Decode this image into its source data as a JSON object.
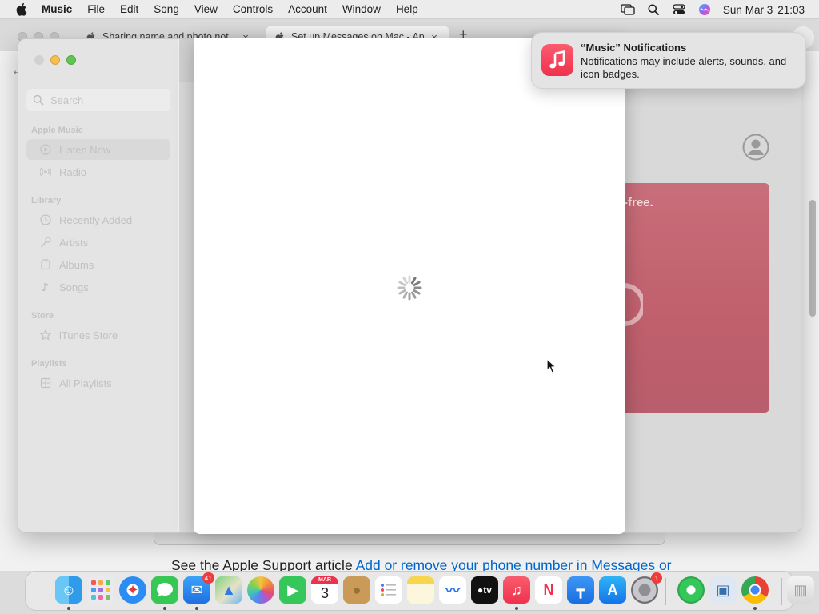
{
  "menubar": {
    "app_name": "Music",
    "items": [
      "File",
      "Edit",
      "Song",
      "View",
      "Controls",
      "Account",
      "Window",
      "Help"
    ],
    "day": "Sun Mar 3",
    "time": "21:03"
  },
  "browser": {
    "tabs": [
      {
        "title": "Sharing name and photo not",
        "close": "×"
      },
      {
        "title": "Set up Messages on Mac - Ap",
        "close": "×"
      }
    ],
    "new_tab": "+",
    "support_text": "See the Apple Support article ",
    "support_link": "Add or remove your phone number in Messages or"
  },
  "music": {
    "search_placeholder": "Search",
    "sections": [
      {
        "heading": "Apple Music",
        "items": [
          {
            "label": "Listen Now",
            "icon": "play-circle-icon",
            "selected": true
          },
          {
            "label": "Radio",
            "icon": "radio-waves-icon"
          }
        ]
      },
      {
        "heading": "Library",
        "items": [
          {
            "label": "Recently Added",
            "icon": "clock-icon"
          },
          {
            "label": "Artists",
            "icon": "microphone-icon"
          },
          {
            "label": "Albums",
            "icon": "album-icon"
          },
          {
            "label": "Songs",
            "icon": "music-note-icon"
          }
        ]
      },
      {
        "heading": "Store",
        "items": [
          {
            "label": "iTunes Store",
            "icon": "star-icon"
          }
        ]
      },
      {
        "heading": "Playlists",
        "items": [
          {
            "label": "All Playlists",
            "icon": "grid-icon"
          }
        ]
      }
    ],
    "promo_text": "-free."
  },
  "notification": {
    "title": "“Music” Notifications",
    "body": "Notifications may include alerts, sounds, and icon badges."
  },
  "dock": {
    "apps": [
      {
        "name": "finder",
        "running": true
      },
      {
        "name": "launchpad"
      },
      {
        "name": "safari"
      },
      {
        "name": "messages",
        "running": true
      },
      {
        "name": "mail",
        "badge": "41",
        "running": true
      },
      {
        "name": "maps"
      },
      {
        "name": "photos"
      },
      {
        "name": "facetime"
      },
      {
        "name": "calendar",
        "month": "MAR",
        "day": "3"
      },
      {
        "name": "contacts"
      },
      {
        "name": "reminders"
      },
      {
        "name": "notes"
      },
      {
        "name": "freeform"
      },
      {
        "name": "apple-tv",
        "label": "tv"
      },
      {
        "name": "music",
        "running": true
      },
      {
        "name": "news"
      },
      {
        "name": "keynote"
      },
      {
        "name": "app-store"
      },
      {
        "name": "system-settings",
        "badge": "1"
      },
      {
        "name": "find-my"
      },
      {
        "name": "preview"
      },
      {
        "name": "chrome",
        "running": true
      },
      {
        "name": "trash"
      }
    ]
  },
  "colors": {
    "music_red": "#f0314d",
    "link_blue": "#0066cc",
    "badge_red": "#ef3b3b"
  }
}
